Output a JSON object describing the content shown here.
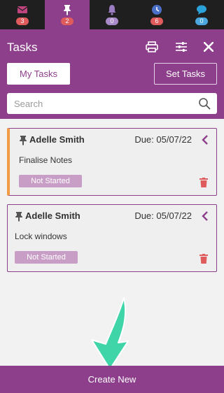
{
  "tabs": [
    {
      "icon": "envelope-icon",
      "badge": "3",
      "badge_color": "#e05b5b"
    },
    {
      "icon": "pin-icon",
      "badge": "2",
      "badge_color": "#e05b5b",
      "active": true
    },
    {
      "icon": "bell-icon",
      "badge": "0",
      "badge_color": "#a98bc9"
    },
    {
      "icon": "clock-icon",
      "badge": "6",
      "badge_color": "#e05b5b"
    },
    {
      "icon": "chat-icon",
      "badge": "0",
      "badge_color": "#4aa8de"
    }
  ],
  "header": {
    "title": "Tasks",
    "my_tasks_label": "My Tasks",
    "set_tasks_label": "Set Tasks",
    "search_placeholder": "Search"
  },
  "tasks": [
    {
      "name": "Adelle Smith",
      "due": "Due: 05/07/22",
      "description": "Finalise Notes",
      "status": "Not Started",
      "highlighted": true
    },
    {
      "name": "Adelle Smith",
      "due": "Due: 05/07/22",
      "description": "Lock windows",
      "status": "Not Started",
      "highlighted": false
    }
  ],
  "footer": {
    "create_label": "Create New"
  },
  "colors": {
    "brand": "#8d3f8c",
    "accent_orange": "#f29b45",
    "status_pill": "#c89ec6",
    "trash": "#e05b5b",
    "arrow": "#3fd5a8"
  }
}
